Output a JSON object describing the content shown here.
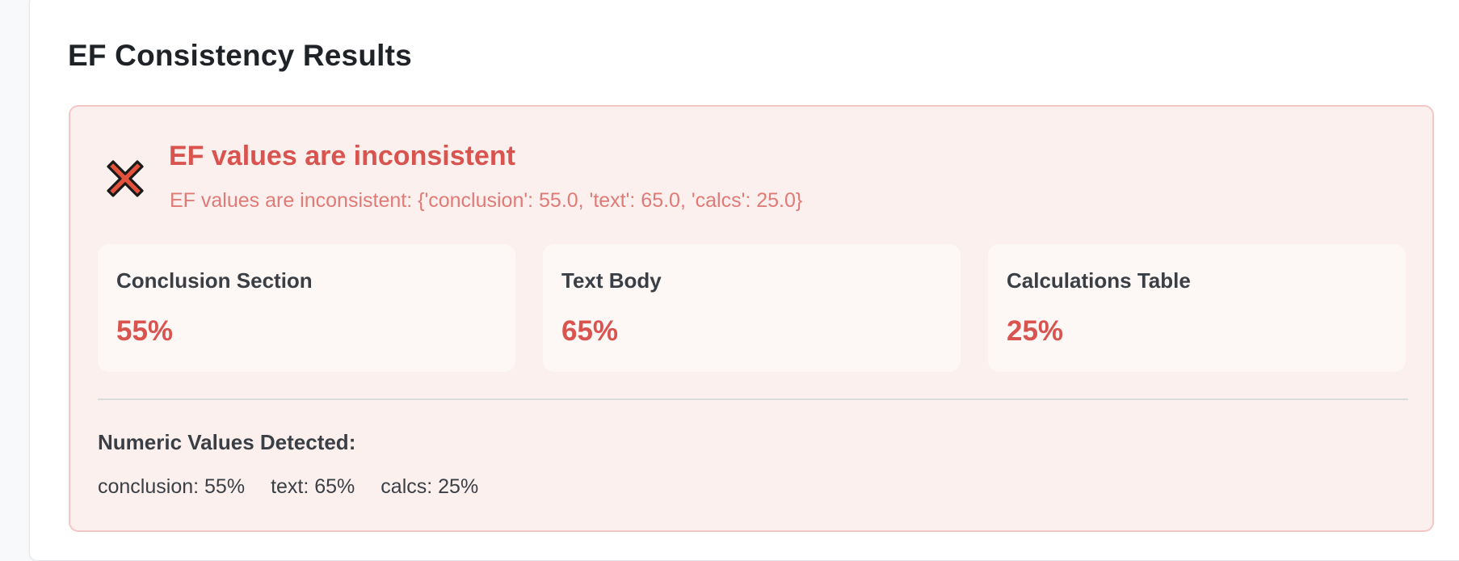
{
  "card": {
    "title": "EF Consistency Results"
  },
  "alert": {
    "status": "error",
    "icon": "x-mark-icon",
    "title": "EF values are inconsistent",
    "message": "EF values are inconsistent: {'conclusion': 55.0, 'text': 65.0, 'calcs': 25.0}",
    "colors": {
      "accent": "#d9534f",
      "background": "#fcf0ef",
      "border": "#f4c7c6"
    }
  },
  "metrics": [
    {
      "label": "Conclusion Section",
      "value": "55%"
    },
    {
      "label": "Text Body",
      "value": "65%"
    },
    {
      "label": "Calculations Table",
      "value": "25%"
    }
  ],
  "numeric": {
    "heading": "Numeric Values Detected:",
    "values": [
      "conclusion: 55%",
      "text: 65%",
      "calcs: 25%"
    ]
  }
}
